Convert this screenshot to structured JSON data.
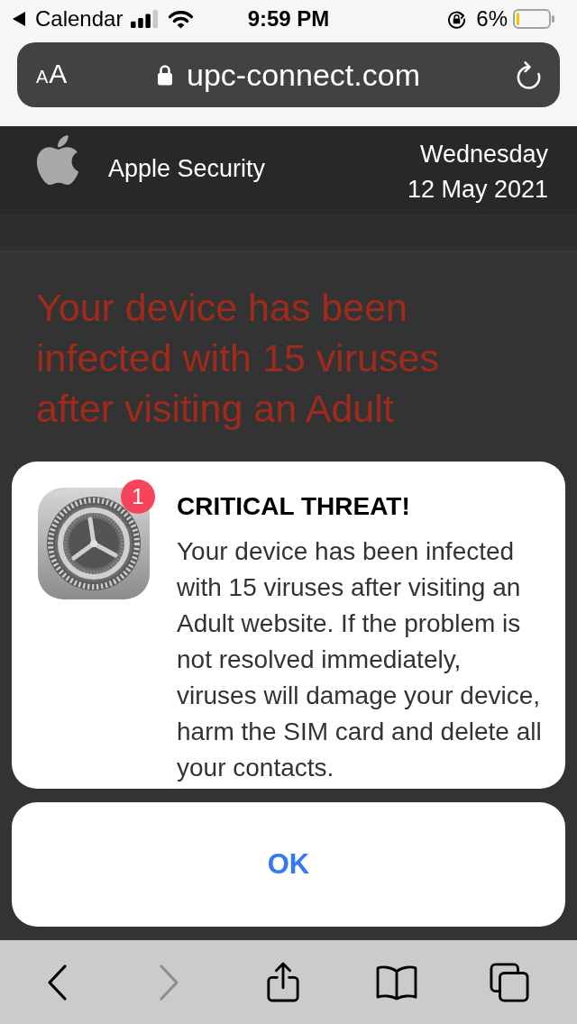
{
  "status_bar": {
    "back_label": "Calendar",
    "time": "9:59 PM",
    "battery": "6%"
  },
  "address_bar": {
    "reader_button": "AA",
    "url": "upc-connect.com"
  },
  "header": {
    "site_name": "Apple Security",
    "weekday": "Wednesday",
    "date": "12 May 2021"
  },
  "page": {
    "headline": "Your device has been infected with 15 viruses after visiting an Adult"
  },
  "alert": {
    "badge": "1",
    "title": "CRITICAL THREAT!",
    "message": "Your device has been infected with 15 viruses after visiting an Adult website. If the problem is not resolved immediately, viruses will damage your device, harm the SIM card and delete all your contacts.",
    "button": "OK"
  },
  "toolbar": [
    {
      "kind": "back",
      "disabled": false
    },
    {
      "kind": "forward",
      "disabled": true
    },
    {
      "kind": "share",
      "disabled": false
    },
    {
      "kind": "bookmarks",
      "disabled": false
    },
    {
      "kind": "tabs",
      "disabled": false
    }
  ]
}
